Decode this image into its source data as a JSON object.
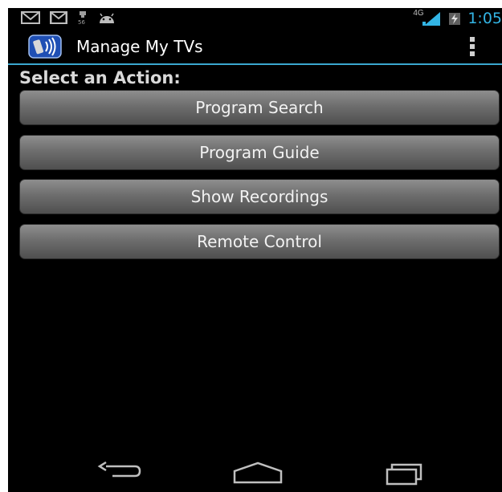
{
  "status_bar": {
    "icons_left": [
      "mail-icon",
      "gmail-icon",
      "sd-card-icon",
      "android-icon"
    ],
    "network_label": "4G",
    "time": "1:05",
    "accent_color": "#33b5e5"
  },
  "action_bar": {
    "title": "Manage My TVs",
    "app_icon": "tv-remote-app-icon",
    "menu_icon": "overflow-menu-icon"
  },
  "main": {
    "heading": "Select an Action:",
    "buttons": [
      {
        "label": "Program Search"
      },
      {
        "label": "Program Guide"
      },
      {
        "label": "Show Recordings"
      },
      {
        "label": "Remote Control"
      }
    ]
  },
  "nav_bar": {
    "icons": [
      "back-icon",
      "home-icon",
      "recent-apps-icon"
    ]
  }
}
